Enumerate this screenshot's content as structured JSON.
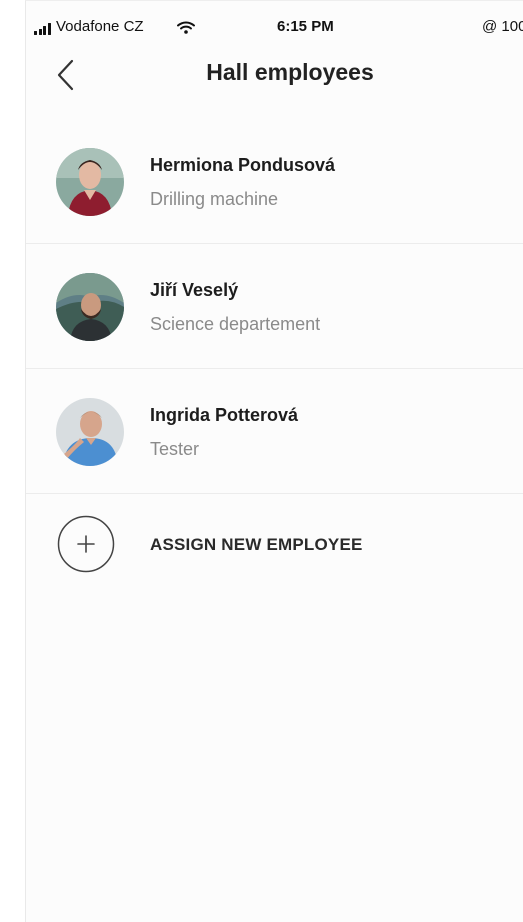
{
  "status_bar": {
    "carrier": "Vodafone CZ",
    "time": "6:15 PM",
    "battery": "@ 100"
  },
  "header": {
    "title": "Hall employees"
  },
  "employees": [
    {
      "name": "Hermiona Pondusová",
      "role": "Drilling machine"
    },
    {
      "name": "Jiří Veselý",
      "role": "Science departement"
    },
    {
      "name": "Ingrida Potterová",
      "role": "Tester"
    }
  ],
  "actions": {
    "assign_label": "ASSIGN NEW EMPLOYEE"
  },
  "colors": {
    "background": "#fcfcfc",
    "divider": "#ececec",
    "primary_text": "#1d1d1d",
    "secondary_text": "#8a8a8a"
  },
  "icons": {
    "back": "chevron-left-icon",
    "add": "plus-circle-icon",
    "signal": "signal-icon",
    "wifi": "wifi-icon",
    "battery": "battery-icon"
  }
}
